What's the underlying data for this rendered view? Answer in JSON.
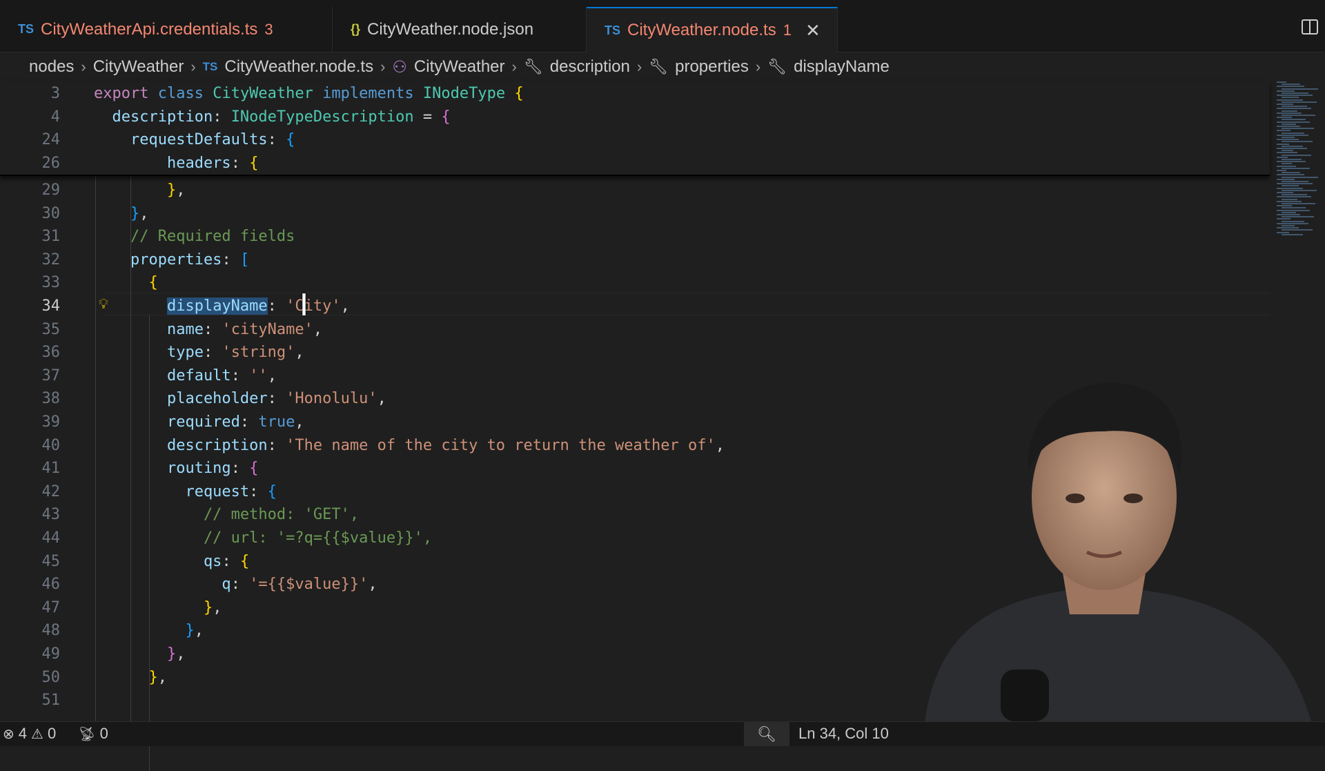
{
  "tabs": [
    {
      "lang": "TS",
      "label": "CityWeatherApi.credentials.ts",
      "count": "3",
      "error": true
    },
    {
      "lang": "{}",
      "label": "CityWeather.node.json",
      "count": "",
      "error": false
    },
    {
      "lang": "TS",
      "label": "CityWeather.node.ts",
      "count": "1",
      "error": true,
      "active": true
    }
  ],
  "breadcrumb": [
    "nodes",
    "CityWeather",
    "CityWeather.node.ts",
    "CityWeather",
    "description",
    "properties",
    "displayName"
  ],
  "sticky_lines": [
    {
      "num": "3",
      "parts": [
        [
          "kw",
          "export "
        ],
        [
          "kw2",
          "class "
        ],
        [
          "cls",
          "CityWeather "
        ],
        [
          "kw2",
          "implements "
        ],
        [
          "cls",
          "INodeType "
        ],
        [
          "p1",
          "{"
        ]
      ]
    },
    {
      "num": "4",
      "parts": [
        [
          "prop",
          "  description"
        ],
        [
          "op",
          ": "
        ],
        [
          "cls",
          "INodeTypeDescription "
        ],
        [
          "op",
          "= "
        ],
        [
          "p2",
          "{"
        ]
      ]
    },
    {
      "num": "24",
      "parts": [
        [
          "prop",
          "    requestDefaults"
        ],
        [
          "op",
          ": "
        ],
        [
          "p3",
          "{"
        ]
      ]
    },
    {
      "num": "26",
      "parts": [
        [
          "prop",
          "        headers"
        ],
        [
          "op",
          ": "
        ],
        [
          "p1",
          "{"
        ]
      ]
    }
  ],
  "lines": [
    {
      "num": "29",
      "parts": [
        [
          "op",
          "        "
        ],
        [
          "p1",
          "}"
        ],
        [
          "op",
          ","
        ]
      ]
    },
    {
      "num": "30",
      "parts": [
        [
          "op",
          "    "
        ],
        [
          "p3",
          "}"
        ],
        [
          "op",
          ","
        ]
      ]
    },
    {
      "num": "31",
      "parts": [
        [
          "cmt",
          "    // Required fields"
        ]
      ]
    },
    {
      "num": "32",
      "parts": [
        [
          "prop",
          "    properties"
        ],
        [
          "op",
          ": "
        ],
        [
          "p3",
          "["
        ]
      ]
    },
    {
      "num": "33",
      "parts": [
        [
          "op",
          "      "
        ],
        [
          "p1",
          "{"
        ]
      ]
    },
    {
      "num": "34",
      "parts": [
        [
          "op",
          "        "
        ],
        [
          "prop sel",
          "displayName"
        ],
        [
          "op",
          ": "
        ],
        [
          "str",
          "'City'"
        ],
        [
          "op",
          ","
        ]
      ],
      "current": true
    },
    {
      "num": "35",
      "parts": [
        [
          "prop",
          "        name"
        ],
        [
          "op",
          ": "
        ],
        [
          "str",
          "'cityName'"
        ],
        [
          "op",
          ","
        ]
      ]
    },
    {
      "num": "36",
      "parts": [
        [
          "prop",
          "        type"
        ],
        [
          "op",
          ": "
        ],
        [
          "str",
          "'string'"
        ],
        [
          "op",
          ","
        ]
      ]
    },
    {
      "num": "37",
      "parts": [
        [
          "prop",
          "        default"
        ],
        [
          "op",
          ": "
        ],
        [
          "str",
          "''"
        ],
        [
          "op",
          ","
        ]
      ]
    },
    {
      "num": "38",
      "parts": [
        [
          "prop",
          "        placeholder"
        ],
        [
          "op",
          ": "
        ],
        [
          "str",
          "'Honolulu'"
        ],
        [
          "op",
          ","
        ]
      ]
    },
    {
      "num": "39",
      "parts": [
        [
          "prop",
          "        required"
        ],
        [
          "op",
          ": "
        ],
        [
          "lit",
          "true"
        ],
        [
          "op",
          ","
        ]
      ]
    },
    {
      "num": "40",
      "parts": [
        [
          "prop",
          "        description"
        ],
        [
          "op",
          ": "
        ],
        [
          "str",
          "'The name of the city to return the weather of'"
        ],
        [
          "op",
          ","
        ]
      ]
    },
    {
      "num": "41",
      "parts": [
        [
          "prop",
          "        routing"
        ],
        [
          "op",
          ": "
        ],
        [
          "p2",
          "{"
        ]
      ]
    },
    {
      "num": "42",
      "parts": [
        [
          "prop",
          "          request"
        ],
        [
          "op",
          ": "
        ],
        [
          "p3",
          "{"
        ]
      ]
    },
    {
      "num": "43",
      "parts": [
        [
          "cmt",
          "            // method: 'GET',"
        ]
      ]
    },
    {
      "num": "44",
      "parts": [
        [
          "cmt",
          "            // url: '=?q={{$value}}',"
        ]
      ]
    },
    {
      "num": "45",
      "parts": [
        [
          "prop",
          "            qs"
        ],
        [
          "op",
          ": "
        ],
        [
          "p1",
          "{"
        ]
      ]
    },
    {
      "num": "46",
      "parts": [
        [
          "prop",
          "              q"
        ],
        [
          "op",
          ": "
        ],
        [
          "str",
          "'={{$value}}'"
        ],
        [
          "op",
          ","
        ]
      ]
    },
    {
      "num": "47",
      "parts": [
        [
          "op",
          "            "
        ],
        [
          "p1",
          "}"
        ],
        [
          "op",
          ","
        ]
      ]
    },
    {
      "num": "48",
      "parts": [
        [
          "op",
          "          "
        ],
        [
          "p3",
          "}"
        ],
        [
          "op",
          ","
        ]
      ]
    },
    {
      "num": "49",
      "parts": [
        [
          "op",
          "        "
        ],
        [
          "p2",
          "}"
        ],
        [
          "op",
          ","
        ]
      ]
    },
    {
      "num": "50",
      "parts": [
        [
          "op",
          "      "
        ],
        [
          "p1",
          "}"
        ],
        [
          "op",
          ","
        ]
      ]
    },
    {
      "num": "51",
      "parts": []
    }
  ],
  "status": {
    "errors": "4",
    "warnings": "0",
    "ports": "0",
    "position": "Ln 34, Col 10"
  },
  "icons": {
    "error": "error-circle-icon",
    "warning": "warning-triangle-icon",
    "broadcast": "broadcast-icon",
    "zoom": "zoom-icon",
    "lightbulb": "lightbulb-icon"
  }
}
